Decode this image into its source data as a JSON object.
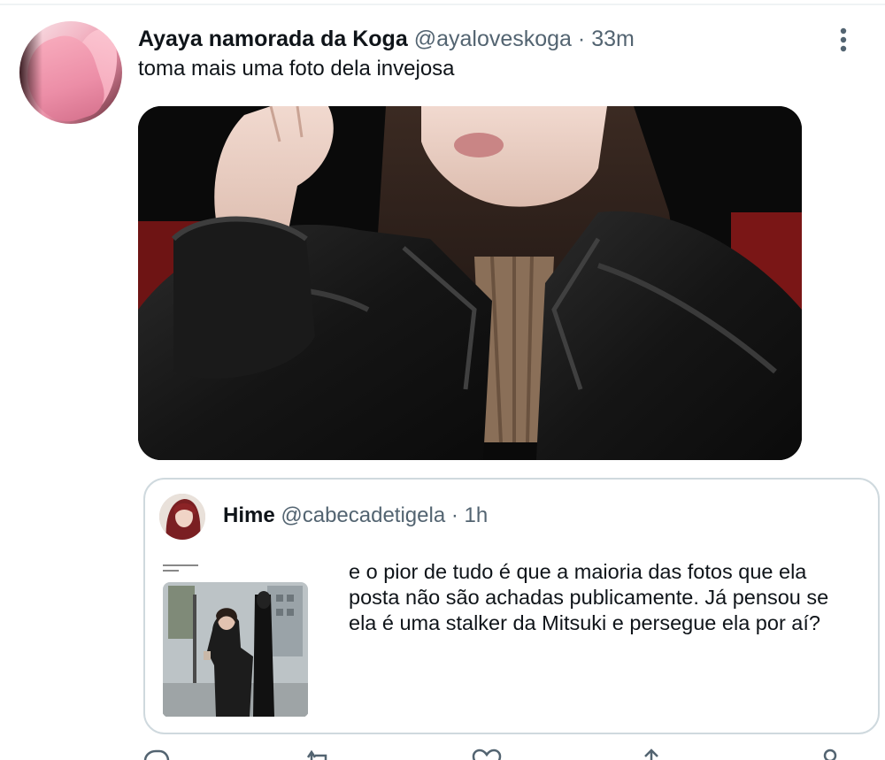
{
  "tweet": {
    "display_name": "Ayaya namorada da Koga",
    "handle": "@ayaloveskoga",
    "separator": "·",
    "time": "33m",
    "text": "toma mais uma foto dela invejosa",
    "avatar_icon": "pink-hair-avatar",
    "more_icon": "more-vertical-icon",
    "photo_icon": "photo-leather-jacket"
  },
  "quote": {
    "display_name": "Hime",
    "handle": "@cabecadetigela",
    "separator": "·",
    "time": "1h",
    "text": "e o pior de tudo é que a maioria das fotos que ela posta não são achadas publicamente. Já pensou se ela é uma stalker da Mitsuki e persegue ela por aí?",
    "thumbnail_icon": "street-photo-thumbnail"
  },
  "actions": {
    "icons": [
      "reply-icon",
      "retweet-icon",
      "like-icon",
      "share-icon",
      "analytics-icon"
    ]
  },
  "colors": {
    "text_primary": "#0f1419",
    "text_secondary": "#536471",
    "border": "#cfd9de",
    "divider": "#eff3f4",
    "background": "#ffffff"
  }
}
